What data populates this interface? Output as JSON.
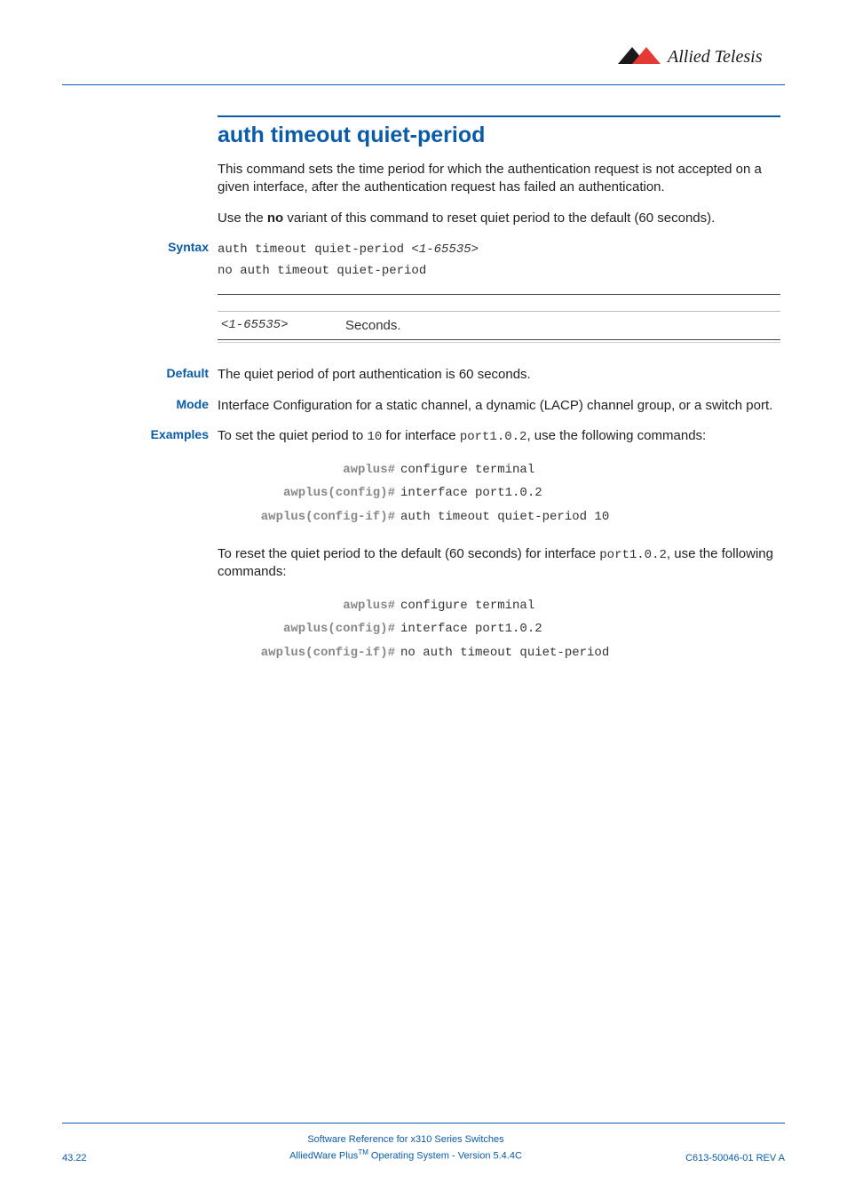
{
  "logo_text": "Allied Telesis",
  "title": "auth timeout quiet-period",
  "intro1": "This command sets the time period for which the authentication request is not accepted on a given interface, after the authentication request has failed an authentication.",
  "intro2_a": "Use the ",
  "intro2_b": "no",
  "intro2_c": " variant of this command to reset quiet period to the default (60 seconds).",
  "labels": {
    "syntax": "Syntax",
    "default": "Default",
    "mode": "Mode",
    "examples": "Examples"
  },
  "syntax": {
    "line1_a": "auth timeout quiet-period <",
    "line1_b": "1-65535",
    "line1_c": ">",
    "line2": "no auth timeout quiet-period"
  },
  "param": {
    "name": "<1-65535>",
    "desc": "Seconds."
  },
  "default_text": "The quiet period of port authentication is 60 seconds.",
  "mode_text": "Interface Configuration for a static channel, a dynamic (LACP) channel group, or a switch port.",
  "examples": {
    "intro1_a": "To set the quiet period to ",
    "intro1_b": "10",
    "intro1_c": " for interface ",
    "intro1_d": "port1.0.2",
    "intro1_e": ", use the following commands:",
    "block1": [
      {
        "prompt": "awplus#",
        "cmd": "configure terminal"
      },
      {
        "prompt": "awplus(config)#",
        "cmd": "interface port1.0.2"
      },
      {
        "prompt": "awplus(config-if)#",
        "cmd": "auth timeout quiet-period 10"
      }
    ],
    "intro2_a": "To reset the quiet period to the default (60 seconds) for interface ",
    "intro2_b": "port1.0.2",
    "intro2_c": ", use the following commands:",
    "block2": [
      {
        "prompt": "awplus#",
        "cmd": "configure terminal"
      },
      {
        "prompt": "awplus(config)#",
        "cmd": "interface port1.0.2"
      },
      {
        "prompt": "awplus(config-if)#",
        "cmd": "no auth timeout quiet-period"
      }
    ]
  },
  "footer": {
    "page": "43.22",
    "center1": "Software Reference for x310 Series Switches",
    "center2_a": "AlliedWare Plus",
    "center2_b": "TM",
    "center2_c": " Operating System  - Version 5.4.4C",
    "right": "C613-50046-01 REV A"
  }
}
